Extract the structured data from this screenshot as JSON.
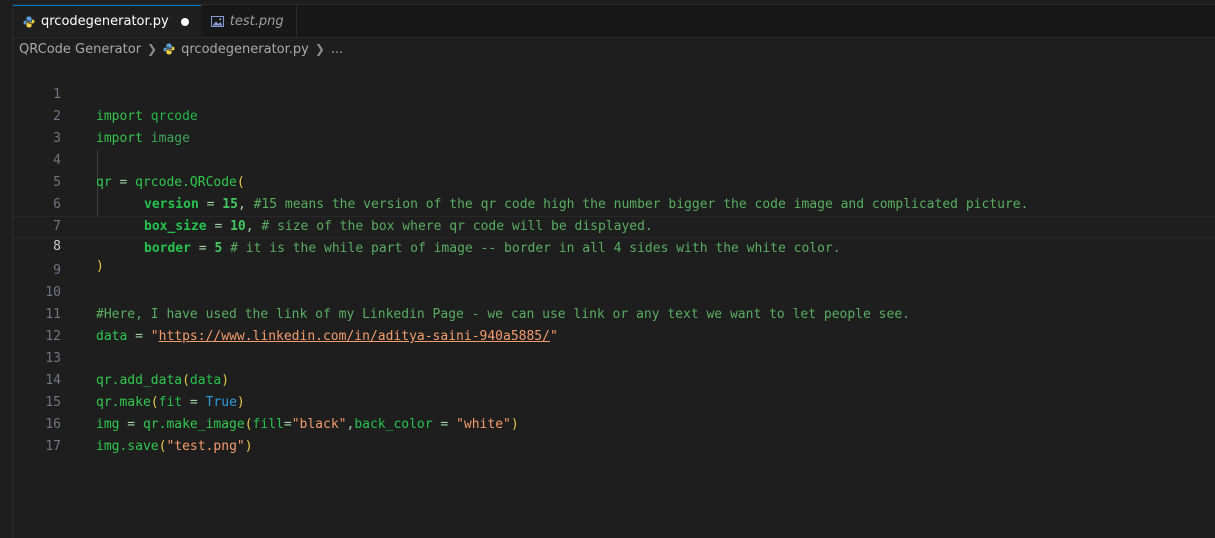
{
  "tabs": [
    {
      "label": "qrcodegenerator.py",
      "icon": "python-icon",
      "modified": true,
      "active": true
    },
    {
      "label": "test.png",
      "icon": "image-icon",
      "modified": false,
      "active": false
    }
  ],
  "breadcrumb": {
    "folder": "QRCode Generator",
    "file": "qrcodegenerator.py",
    "more": "..."
  },
  "editor": {
    "current_line": 8,
    "lines": [
      {
        "n": "1"
      },
      {
        "n": "2"
      },
      {
        "n": "3"
      },
      {
        "n": "4"
      },
      {
        "n": "5"
      },
      {
        "n": "6"
      },
      {
        "n": "7"
      },
      {
        "n": "8"
      },
      {
        "n": "9"
      },
      {
        "n": "10"
      },
      {
        "n": "11"
      },
      {
        "n": "12"
      },
      {
        "n": "13"
      },
      {
        "n": "14"
      },
      {
        "n": "15"
      },
      {
        "n": "16"
      },
      {
        "n": "17"
      }
    ],
    "tokens": {
      "l1_kw": "import",
      "l1_mod": "qrcode",
      "l2_kw": "import",
      "l2_mod": "image",
      "l4_var": "qr",
      "l4_op": " = ",
      "l4_call": "qrcode.QRCode",
      "l4_paren": "(",
      "l5_param": "version",
      "l5_op": " = ",
      "l5_num": "15",
      "l5_comma": ",",
      "l5_cmt": " #15 means the version of the qr code high the number bigger the code image and complicated picture.",
      "l6_param": "box_size",
      "l6_op": " = ",
      "l6_num": "10",
      "l6_comma": ",",
      "l6_cmt": " # size of the box where qr code will be displayed.",
      "l7_param": "border",
      "l7_op": " = ",
      "l7_num": "5",
      "l7_cmt": " # it is the while part of image -- border in all 4 sides with the white color.",
      "l8_paren": ")",
      "l10_cmt": "#Here, I have used the link of my Linkedin Page - we can use link or any text we want to let people see.",
      "l11_var": "data",
      "l11_op": " = ",
      "l11_q1": "\"",
      "l11_url": "https://www.linkedin.com/in/aditya-saini-940a5885/",
      "l11_q2": "\"",
      "l13_call": "qr.add_data",
      "l13_p1": "(",
      "l13_arg": "data",
      "l13_p2": ")",
      "l14_call": "qr.make",
      "l14_p1": "(",
      "l14_arg": "fit",
      "l14_op": " = ",
      "l14_bool": "True",
      "l14_p2": ")",
      "l15_var": "img",
      "l15_op": " = ",
      "l15_call": "qr.make_image",
      "l15_p1": "(",
      "l15_arg1": "fill",
      "l15_eq1": "=",
      "l15_s1": "\"black\"",
      "l15_comma": ",",
      "l15_arg2": "back_color",
      "l15_eq2": " = ",
      "l15_s2": "\"white\"",
      "l15_p2": ")",
      "l16_call": "img.save",
      "l16_p1": "(",
      "l16_s": "\"test.png\"",
      "l16_p2": ")"
    }
  }
}
